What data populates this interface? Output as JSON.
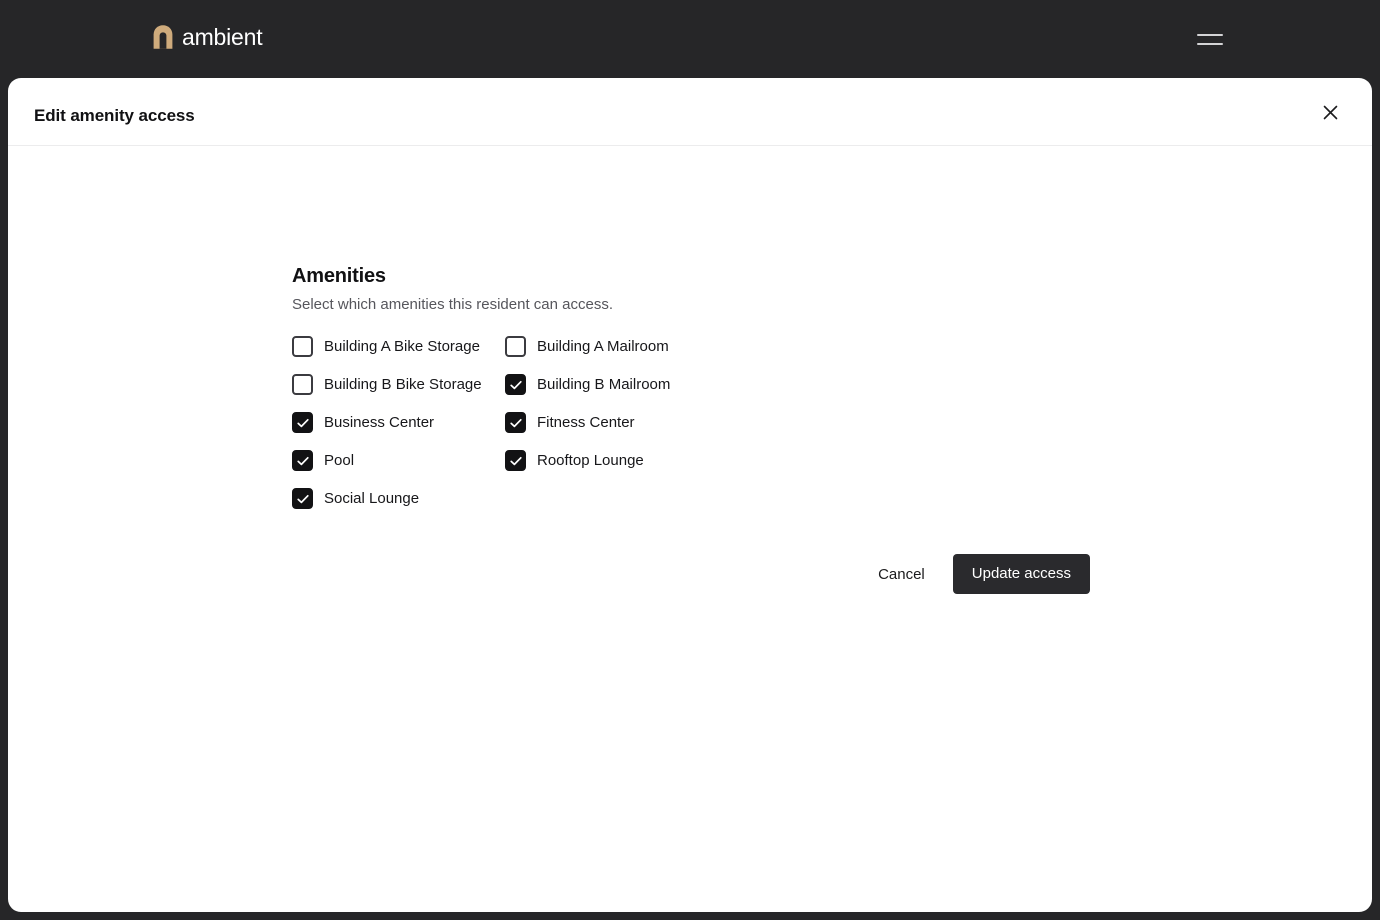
{
  "appbar": {
    "brand_name": "ambient",
    "brand_icon": "arch-logo-icon",
    "menu_icon": "hamburger-menu-icon",
    "background": "#262628",
    "brand_mark_color": "#cfab7c"
  },
  "modal": {
    "title": "Edit amenity access",
    "close_icon": "close-x-icon",
    "section": {
      "title": "Amenities",
      "subtitle": "Select which amenities this resident can access.",
      "amenities": [
        {
          "label": "Building A Bike Storage",
          "checked": false
        },
        {
          "label": "Building A Mailroom",
          "checked": false
        },
        {
          "label": "Building B Bike Storage",
          "checked": false
        },
        {
          "label": "Building B Mailroom",
          "checked": true
        },
        {
          "label": "Business Center",
          "checked": true
        },
        {
          "label": "Fitness Center",
          "checked": true
        },
        {
          "label": "Pool",
          "checked": true
        },
        {
          "label": "Rooftop Lounge",
          "checked": true
        },
        {
          "label": "Social Lounge",
          "checked": true
        }
      ]
    },
    "actions": {
      "cancel_label": "Cancel",
      "submit_label": "Update access",
      "submit_color": "#2a2a2d"
    }
  }
}
